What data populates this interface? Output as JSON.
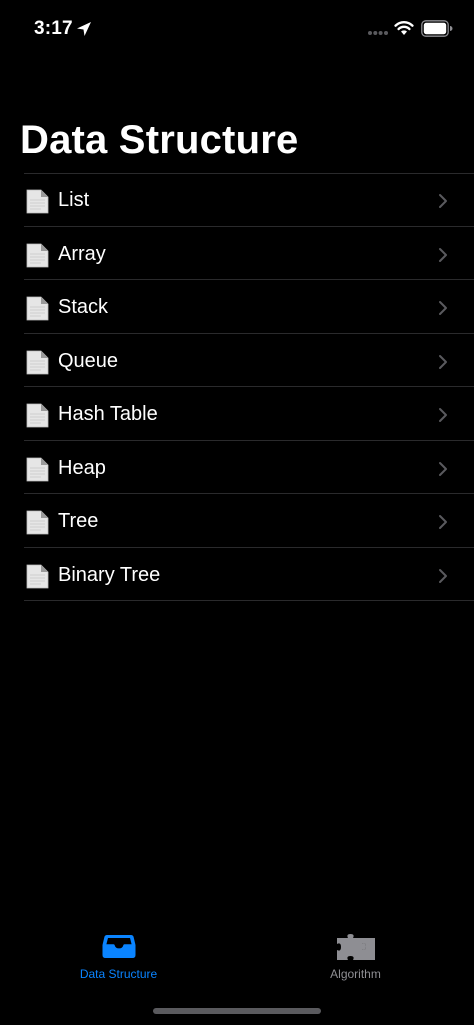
{
  "status_bar": {
    "time": "3:17",
    "icons": [
      "location-arrow-icon",
      "signal-icon",
      "wifi-icon",
      "battery-icon"
    ]
  },
  "header": {
    "title": "Data Structure"
  },
  "list": {
    "items": [
      {
        "label": "List",
        "icon": "document-icon"
      },
      {
        "label": "Array",
        "icon": "document-icon"
      },
      {
        "label": "Stack",
        "icon": "document-icon"
      },
      {
        "label": "Queue",
        "icon": "document-icon"
      },
      {
        "label": "Hash Table",
        "icon": "document-icon"
      },
      {
        "label": "Heap",
        "icon": "document-icon"
      },
      {
        "label": "Tree",
        "icon": "document-icon"
      },
      {
        "label": "Binary Tree",
        "icon": "document-icon"
      }
    ]
  },
  "tab_bar": {
    "tabs": [
      {
        "label": "Data Structure",
        "icon": "tray-icon",
        "selected": true
      },
      {
        "label": "Algorithm",
        "icon": "puzzle-piece-icon",
        "selected": false
      }
    ]
  },
  "colors": {
    "background": "#000000",
    "accent": "#0a84ff",
    "inactive_tab": "#8e8e93",
    "separator": "#2a2a2c",
    "chevron": "#5a5a5e"
  }
}
